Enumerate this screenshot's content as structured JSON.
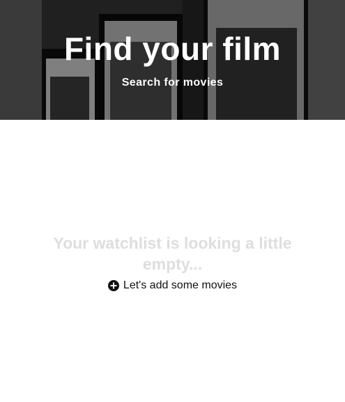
{
  "hero": {
    "title": "Find your film",
    "subtitle": "Search for movies",
    "background_image": "movie-posters-wall-image"
  },
  "empty_state": {
    "message": "Your watchlist is looking a little empty...",
    "add_link_label": "Let's add some movies",
    "add_icon": "plus-circle-icon"
  },
  "colors": {
    "hero_text": "#ffffff",
    "empty_message": "#dfdddd",
    "link_text": "#111111"
  }
}
